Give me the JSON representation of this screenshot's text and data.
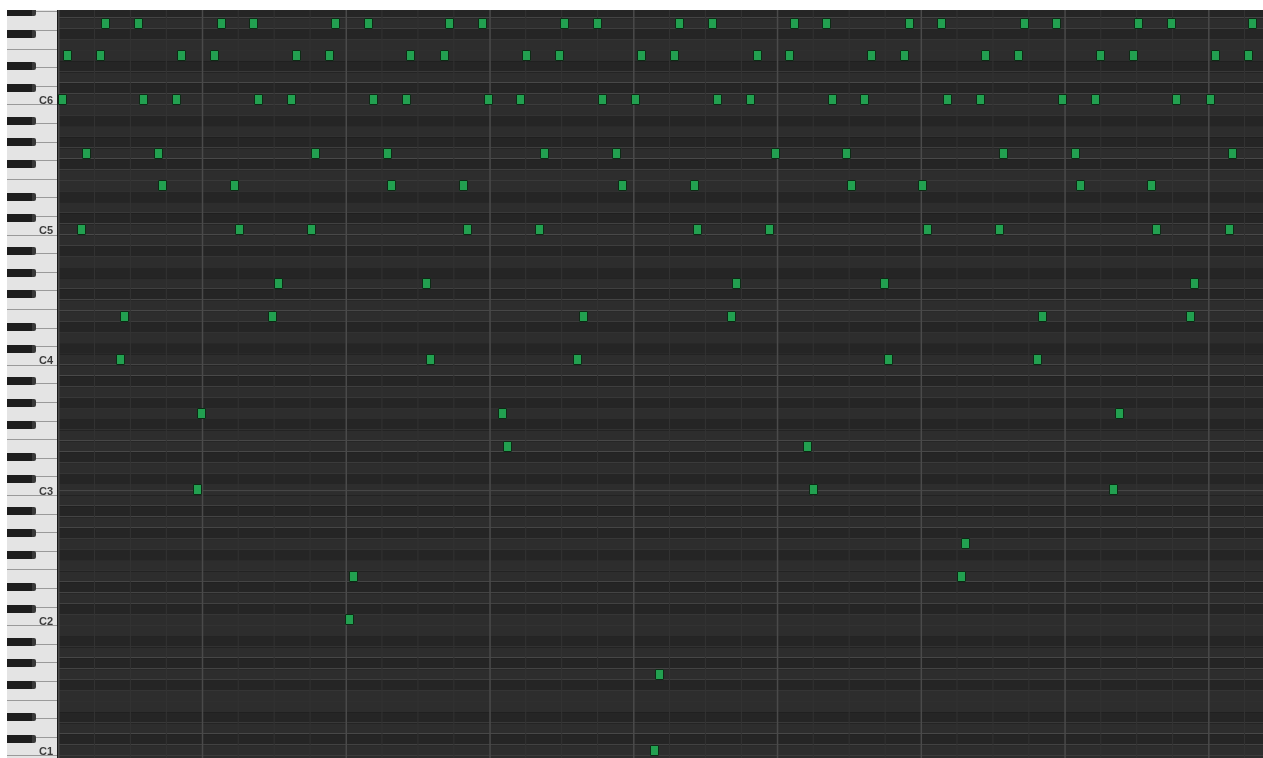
{
  "keyboard": {
    "octave_labels": [
      "C6",
      "C5",
      "C4",
      "C3",
      "C2",
      "C1"
    ]
  }
}
